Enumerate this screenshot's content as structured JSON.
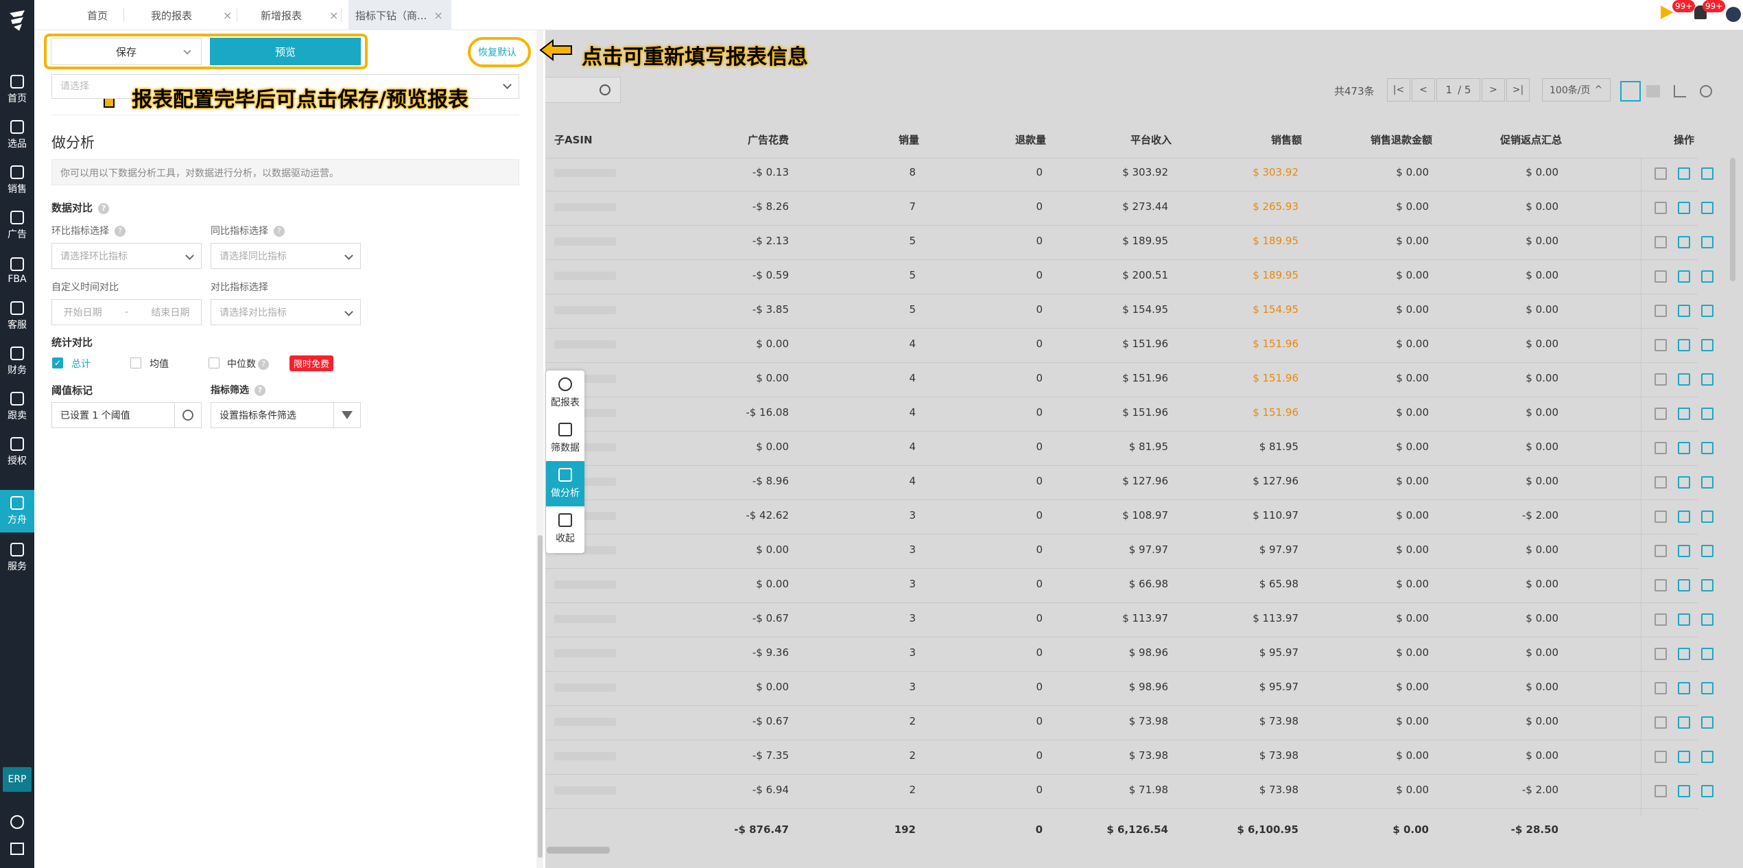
{
  "nav": {
    "items": [
      {
        "label": "首页",
        "icon": "home-icon"
      },
      {
        "label": "选品",
        "icon": "search-icon"
      },
      {
        "label": "销售",
        "icon": "chart-line-icon"
      },
      {
        "label": "广告",
        "icon": "ad-icon"
      },
      {
        "label": "FBA",
        "icon": "warehouse-icon"
      },
      {
        "label": "客服",
        "icon": "service-icon"
      },
      {
        "label": "财务",
        "icon": "finance-icon"
      },
      {
        "label": "跟卖",
        "icon": "follow-icon"
      },
      {
        "label": "授权",
        "icon": "shield-icon"
      },
      {
        "label": "方舟",
        "icon": "ark-icon"
      },
      {
        "label": "服务",
        "icon": "service-bag-icon"
      }
    ],
    "erp": "ERP"
  },
  "tabs": [
    {
      "label": "首页",
      "closable": false
    },
    {
      "label": "我的报表",
      "closable": true
    },
    {
      "label": "新增报表",
      "closable": true
    },
    {
      "label": "指标下钻（商...",
      "closable": true
    }
  ],
  "header_badges": {
    "flag": "99+",
    "bell": "99+"
  },
  "toolbar": {
    "save": "保存",
    "preview": "预览",
    "reset": "恢复默认"
  },
  "annotations": {
    "reset_tip": "点击可重新填写报表信息",
    "save_tip": "报表配置完毕后可点击保存/预览报表"
  },
  "panel": {
    "top_select_placeholder": "请选择",
    "section_title": "做分析",
    "section_desc": "你可以用以下数据分析工具，对数据进行分析，以数据驱动运营。",
    "compare_title": "数据对比",
    "ring_label": "环比指标选择",
    "ring_placeholder": "请选择环比指标",
    "yoy_label": "同比指标选择",
    "yoy_placeholder": "请选择同比指标",
    "custom_label": "自定义时间对比",
    "start_date": "开始日期",
    "dash": "-",
    "end_date": "结束日期",
    "contrast_label": "对比指标选择",
    "contrast_placeholder": "请选择对比指标",
    "stat_title": "统计对比",
    "stat_total": "总计",
    "stat_avg": "均值",
    "stat_median": "中位数",
    "free_badge": "限时免费",
    "threshold_label": "阈值标记",
    "threshold_value": "已设置 1 个阈值",
    "filter_label": "指标筛选",
    "filter_placeholder": "设置指标条件筛选"
  },
  "pager": {
    "total": "共473条",
    "page": "1",
    "pages": "/ 5",
    "size": "100条/页"
  },
  "table": {
    "headers": [
      "子ASIN",
      "广告花费",
      "销量",
      "退款量",
      "平台收入",
      "销售额",
      "销售退款金额",
      "促销返点汇总",
      "操作"
    ],
    "rows": [
      [
        "-$ 0.13",
        "8",
        "0",
        "$ 303.92",
        "$ 303.92",
        "$ 0.00",
        "$ 0.00"
      ],
      [
        "-$ 8.26",
        "7",
        "0",
        "$ 273.44",
        "$ 265.93",
        "$ 0.00",
        "$ 0.00"
      ],
      [
        "-$ 2.13",
        "5",
        "0",
        "$ 189.95",
        "$ 189.95",
        "$ 0.00",
        "$ 0.00"
      ],
      [
        "-$ 0.59",
        "5",
        "0",
        "$ 200.51",
        "$ 189.95",
        "$ 0.00",
        "$ 0.00"
      ],
      [
        "-$ 3.85",
        "5",
        "0",
        "$ 154.95",
        "$ 154.95",
        "$ 0.00",
        "$ 0.00"
      ],
      [
        "$ 0.00",
        "4",
        "0",
        "$ 151.96",
        "$ 151.96",
        "$ 0.00",
        "$ 0.00"
      ],
      [
        "$ 0.00",
        "4",
        "0",
        "$ 151.96",
        "$ 151.96",
        "$ 0.00",
        "$ 0.00"
      ],
      [
        "-$ 16.08",
        "4",
        "0",
        "$ 151.96",
        "$ 151.96",
        "$ 0.00",
        "$ 0.00"
      ],
      [
        "$ 0.00",
        "4",
        "0",
        "$ 81.95",
        "$ 81.95",
        "$ 0.00",
        "$ 0.00"
      ],
      [
        "-$ 8.96",
        "4",
        "0",
        "$ 127.96",
        "$ 127.96",
        "$ 0.00",
        "$ 0.00"
      ],
      [
        "-$ 42.62",
        "3",
        "0",
        "$ 108.97",
        "$ 110.97",
        "$ 0.00",
        "-$ 2.00"
      ],
      [
        "$ 0.00",
        "3",
        "0",
        "$ 97.97",
        "$ 97.97",
        "$ 0.00",
        "$ 0.00"
      ],
      [
        "$ 0.00",
        "3",
        "0",
        "$ 66.98",
        "$ 65.98",
        "$ 0.00",
        "$ 0.00"
      ],
      [
        "-$ 0.67",
        "3",
        "0",
        "$ 113.97",
        "$ 113.97",
        "$ 0.00",
        "$ 0.00"
      ],
      [
        "-$ 9.36",
        "3",
        "0",
        "$ 98.96",
        "$ 95.97",
        "$ 0.00",
        "$ 0.00"
      ],
      [
        "$ 0.00",
        "3",
        "0",
        "$ 98.96",
        "$ 95.97",
        "$ 0.00",
        "$ 0.00"
      ],
      [
        "-$ 0.67",
        "2",
        "0",
        "$ 73.98",
        "$ 73.98",
        "$ 0.00",
        "$ 0.00"
      ],
      [
        "-$ 7.35",
        "2",
        "0",
        "$ 73.98",
        "$ 73.98",
        "$ 0.00",
        "$ 0.00"
      ],
      [
        "-$ 6.94",
        "2",
        "0",
        "$ 71.98",
        "$ 73.98",
        "$ 0.00",
        "-$ 2.00"
      ]
    ],
    "highlight_rows": [
      0,
      1,
      2,
      3,
      4,
      5,
      6,
      7
    ],
    "highlight_color": "#e8890c",
    "totals": [
      "-$ 876.47",
      "192",
      "0",
      "$ 6,126.54",
      "$ 6,100.95",
      "$ 0.00",
      "-$ 28.50"
    ]
  },
  "floatmenu": [
    {
      "label": "配报表",
      "icon": "pie-chart-icon"
    },
    {
      "label": "筛数据",
      "icon": "filter-data-icon"
    },
    {
      "label": "做分析",
      "icon": "analysis-icon",
      "active": true
    },
    {
      "label": "收起",
      "icon": "collapse-icon"
    }
  ],
  "colors": {
    "accent": "#19a9c4",
    "annotation": "#f4b400",
    "nav_bg": "#1d2531"
  }
}
